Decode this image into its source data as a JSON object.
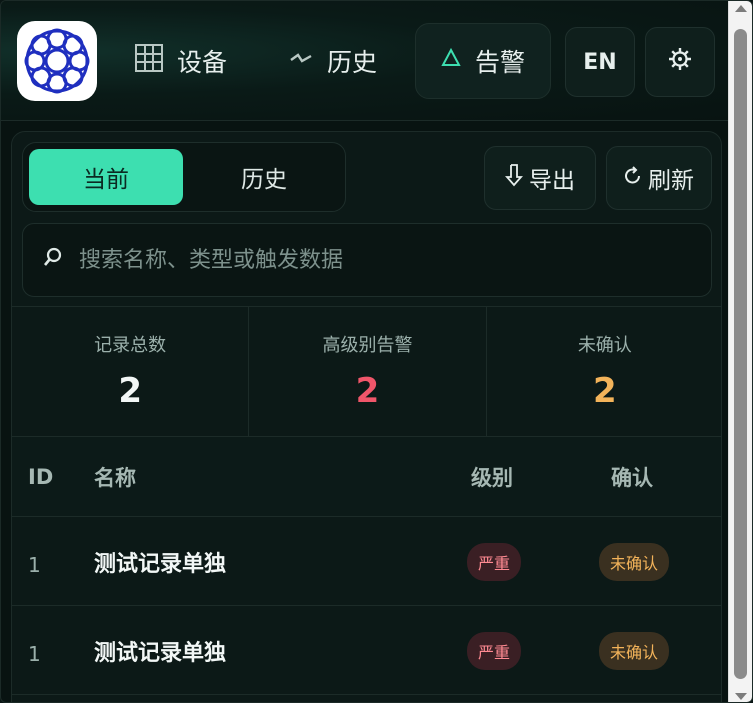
{
  "header": {
    "nav": [
      {
        "label": "设备",
        "icon": "grid-icon"
      },
      {
        "label": "历史",
        "icon": "pulse-icon"
      },
      {
        "label": "告警",
        "icon": "triangle-icon"
      }
    ],
    "lang_label": "EN",
    "settings_icon": "gear-icon"
  },
  "toolbar": {
    "tabs": [
      "当前",
      "历史"
    ],
    "export_label": "导出",
    "refresh_label": "刷新"
  },
  "search": {
    "placeholder": "搜索名称、类型或触发数据"
  },
  "stats": [
    {
      "label": "记录总数",
      "value": "2",
      "color": "#f2f7f6"
    },
    {
      "label": "高级别告警",
      "value": "2",
      "color": "#f0566a"
    },
    {
      "label": "未确认",
      "value": "2",
      "color": "#f3b35a"
    }
  ],
  "table": {
    "columns": [
      "ID",
      "名称",
      "级别",
      "确认"
    ],
    "rows": [
      {
        "id": "1",
        "name": "测试记录单独",
        "severity": "严重",
        "ack": "未确认"
      },
      {
        "id": "1",
        "name": "测试记录单独",
        "severity": "严重",
        "ack": "未确认"
      }
    ]
  },
  "colors": {
    "accent": "#3ddfb0",
    "background": "#081311"
  }
}
